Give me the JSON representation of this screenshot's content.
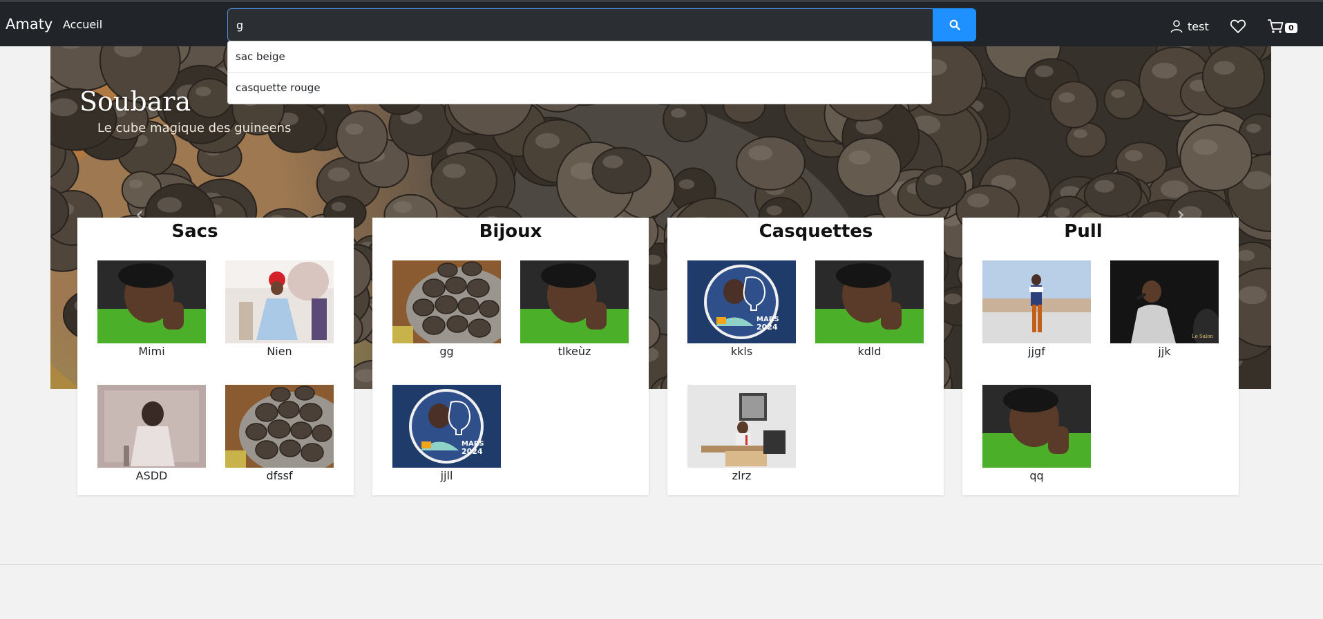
{
  "navbar": {
    "brand": "Amaty",
    "home_link": "Accueil",
    "search": {
      "value": "g"
    },
    "suggestions": [
      "sac beige",
      "casquette rouge"
    ],
    "user": "test",
    "cart_count": "0"
  },
  "hero": {
    "title": "Soubara",
    "subtitle": "Le cube magique des guineens"
  },
  "categories": [
    {
      "title": "Sacs",
      "products": [
        {
          "name": "Mimi",
          "image": "portrait-green-shirt"
        },
        {
          "name": "Nien",
          "image": "woman-blue-dress"
        },
        {
          "name": "ASDD",
          "image": "child-vintage-photo"
        },
        {
          "name": "dfssf",
          "image": "soubara-balls"
        }
      ]
    },
    {
      "title": "Bijoux",
      "products": [
        {
          "name": "gg",
          "image": "soubara-balls"
        },
        {
          "name": "tlkeùz",
          "image": "portrait-green-shirt"
        },
        {
          "name": "jjll",
          "image": "event-poster"
        }
      ]
    },
    {
      "title": "Casquettes",
      "products": [
        {
          "name": "kkls",
          "image": "event-poster"
        },
        {
          "name": "kdld",
          "image": "portrait-green-shirt"
        },
        {
          "name": "zlrz",
          "image": "man-at-desk"
        }
      ]
    },
    {
      "title": "Pull",
      "products": [
        {
          "name": "jjgf",
          "image": "man-standing-outdoor"
        },
        {
          "name": "jjk",
          "image": "man-with-microphone"
        },
        {
          "name": "qq",
          "image": "portrait-green-shirt"
        }
      ]
    }
  ],
  "colors": {
    "navbar_bg": "#212529",
    "search_button": "#1e90ff",
    "page_bg": "#f2f2f2"
  }
}
